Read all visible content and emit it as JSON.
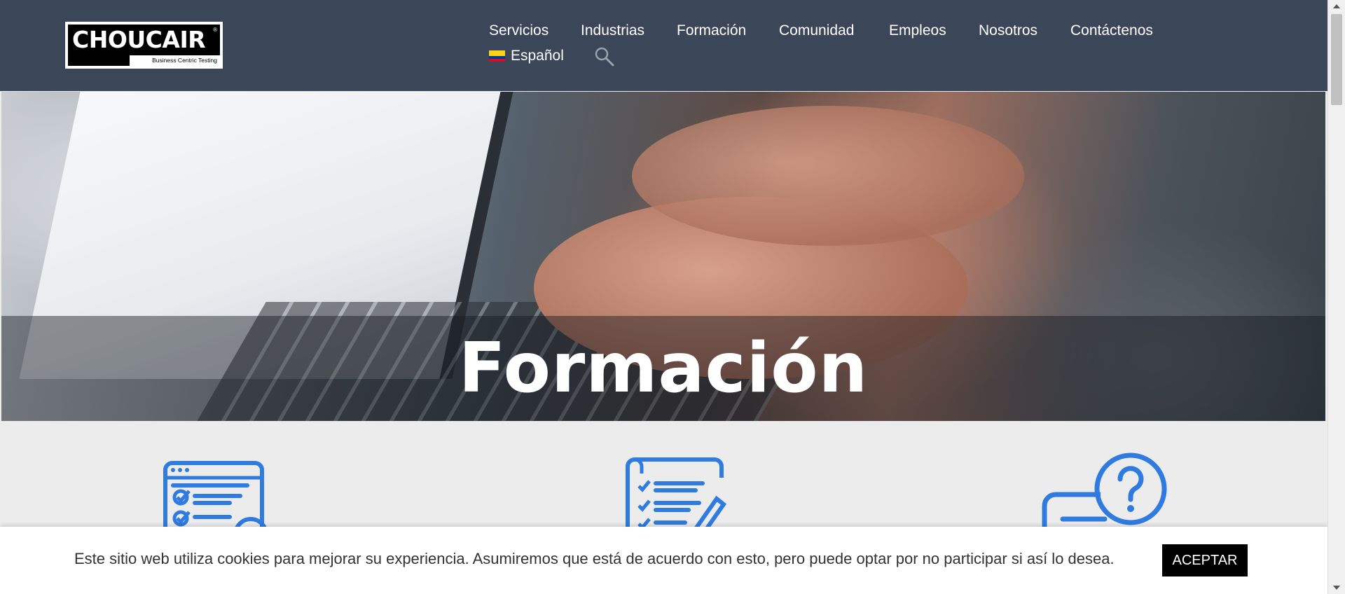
{
  "brand": {
    "name": "CHOUCAIR",
    "tagline": "Business Centric Testing"
  },
  "nav": {
    "items": [
      "Servicios",
      "Industrias",
      "Formación",
      "Comunidad",
      "Empleos",
      "Nosotros",
      "Contáctenos"
    ],
    "language": "Español",
    "language_flag_icon": "colombia-flag-icon",
    "search_icon": "search-icon"
  },
  "hero": {
    "title": "Formación"
  },
  "features": {
    "icons": [
      "checklist-window-icon",
      "document-checklist-pencil-icon",
      "chat-question-icon"
    ],
    "icon_color": "#2f7be0"
  },
  "cookie": {
    "text": "Este sitio web utiliza cookies para mejorar su experiencia. Asumiremos que está de acuerdo con esto, pero puede optar por no participar si así lo desea.",
    "accept_label": "ACEPTAR"
  },
  "colors": {
    "header_bg": "#3b4658",
    "page_bg": "#ececec",
    "accent": "#2f7be0"
  }
}
